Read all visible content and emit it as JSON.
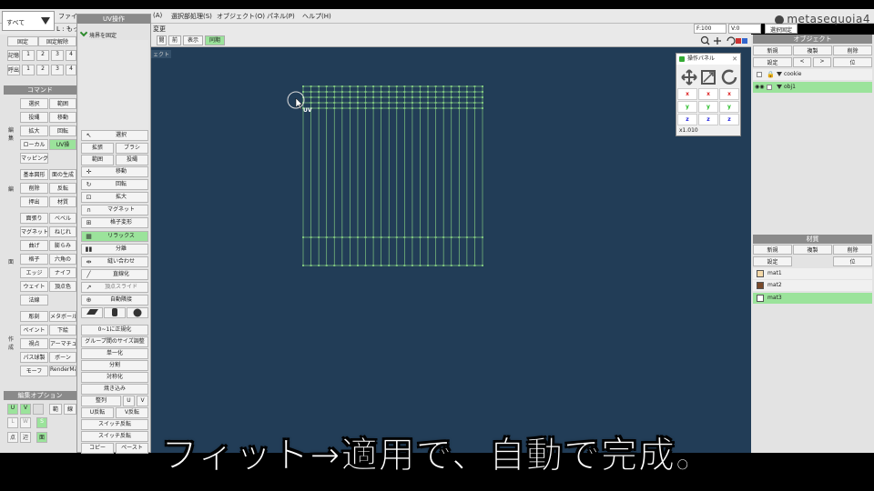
{
  "menu": {
    "select_all": "すべて",
    "items": [
      "ファイ",
      "(A)",
      "選択部処理(S)",
      "オブジェクト(O)",
      "パネル(P)",
      "ヘルプ(H)"
    ]
  },
  "logo": "metasequoia4",
  "toolbar2": {
    "left_text": "L : もっ",
    "mid_text": "変更",
    "f_value": "F:100",
    "v_value": "V:0",
    "select_fix": "選択固定"
  },
  "toolbar3": {
    "fix": "固定",
    "unfix": "固定解除",
    "view_front": "閲",
    "view_back": "前",
    "view_show": "表示",
    "sync": "同期",
    "vp_tag": "ェクト"
  },
  "left_memory": {
    "mem_label": "記憶",
    "recall_label": "呼出",
    "nums": [
      "1",
      "2",
      "3",
      "4"
    ]
  },
  "command": {
    "header": "コマンド",
    "group1_label": "編集",
    "group1": [
      "選択",
      "範囲",
      "投縄",
      "移動",
      "拡大",
      "回転",
      "ローカル",
      "UV操",
      "マッピング"
    ],
    "group2_label": "編",
    "group2": [
      "基本図形",
      "面の生成",
      "削除",
      "反転",
      "押出",
      "材質"
    ],
    "group3_label": "面",
    "group3": [
      "面張り",
      "ベベル",
      "マグネット",
      "ねじれ",
      "曲げ",
      "膨らみ",
      "格子",
      "六角の",
      "エッジ",
      "ナイフ",
      "ウェイト",
      "頂点色",
      "法線"
    ],
    "group4_label": "作成",
    "group4": [
      "彫刻",
      "メタボール",
      "ペイント",
      "下絵",
      "視点",
      "アーマチュア",
      "パス球製",
      "ボーン",
      "モーフ",
      "RenderMan"
    ]
  },
  "edit_options": {
    "header": "編集オプション",
    "row1": [
      "U",
      "V",
      "範",
      "線"
    ],
    "row2": [
      "L",
      "W",
      "S"
    ],
    "row3": [
      "点",
      "辺",
      "面"
    ]
  },
  "uv_panel": {
    "title": "UV操作",
    "boundary_fix": "境界を固定",
    "select": "選択",
    "expand": "拡張",
    "brush": "ブラシ",
    "range": "範囲",
    "lasso": "投縄",
    "move": "移動",
    "rotate": "回転",
    "scale": "拡大",
    "magnet": "マグネット",
    "lattice": "格子変形",
    "relax": "リラックス",
    "split": "分離",
    "stitch": "縫い合わせ",
    "straighten": "直線化",
    "vertex_slide": "頂点スライド",
    "auto_stitch": "自動隣接",
    "normalize": "0~1に正規化",
    "group_size": "グループ間のサイズ調整",
    "unify": "単一化",
    "divide": "分割",
    "symmetrize": "対称化",
    "bake": "焼き込み",
    "align": "整列",
    "align_u": "U",
    "align_v": "V",
    "u_flip": "U反転",
    "v_flip": "V反転",
    "switch_flip": "スイッチ反転",
    "switch_flip2": "スイッチ反転",
    "copy": "コピー",
    "paste": "ペースト"
  },
  "viewport": {
    "uv_label": "UV"
  },
  "op_panel": {
    "title": "操作パネル",
    "x": "x",
    "y": "y",
    "z": "z",
    "scale": "x1.010"
  },
  "objects": {
    "header": "オブジェクト",
    "new": "新規",
    "duplicate": "複製",
    "delete": "削除",
    "settings": "設定",
    "prev": "<",
    "next": ">",
    "pos": "位",
    "items": [
      {
        "name": "cookie",
        "selected": false
      },
      {
        "name": "obj1",
        "selected": true
      }
    ]
  },
  "materials": {
    "header": "材質",
    "new": "新規",
    "duplicate": "複製",
    "delete": "削除",
    "settings": "設定",
    "pos": "位",
    "items": [
      {
        "name": "mat1",
        "color": "#f5d9a8",
        "selected": false
      },
      {
        "name": "mat2",
        "color": "#7a4a2a",
        "selected": false
      },
      {
        "name": "mat3",
        "color": "#ffffff",
        "selected": true
      }
    ]
  },
  "subtitle": "フィット→適用で、自動で完成。",
  "colors": {
    "viewport_bg": "#223d57",
    "grid": "#7fc47f",
    "active": "#9be39b"
  }
}
